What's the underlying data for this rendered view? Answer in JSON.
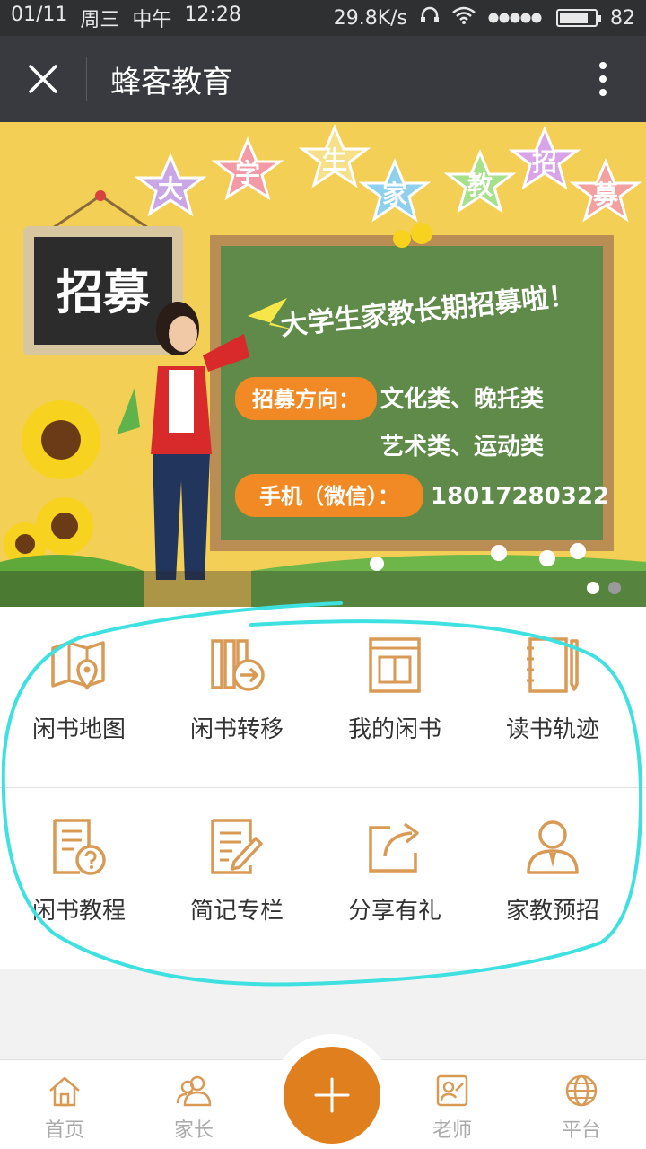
{
  "status": {
    "date": "01/11",
    "weekday": "周三",
    "period": "中午",
    "time": "12:28",
    "speed": "29.8K/s",
    "battery": "82",
    "battery_level": 0.82
  },
  "header": {
    "title": "蜂客教育"
  },
  "banner": {
    "stars": [
      "大",
      "学",
      "生",
      "家",
      "教",
      "招",
      "募"
    ],
    "sign": "招募",
    "headline": "大学生家教长期招募啦！",
    "direction_label": "招募方向：",
    "direction_line1": "文化类、晚托类",
    "direction_line2": "艺术类、运动类",
    "phone_label": "手机（微信）：",
    "phone": "18017280322",
    "slide_count": 2,
    "active_slide": 1
  },
  "grid": {
    "items": [
      {
        "label": "闲书地图",
        "icon": "map-pin-icon"
      },
      {
        "label": "闲书转移",
        "icon": "book-transfer-icon"
      },
      {
        "label": "我的闲书",
        "icon": "my-books-icon"
      },
      {
        "label": "读书轨迹",
        "icon": "notebook-pen-icon"
      },
      {
        "label": "闲书教程",
        "icon": "help-document-icon"
      },
      {
        "label": "简记专栏",
        "icon": "edit-note-icon"
      },
      {
        "label": "分享有礼",
        "icon": "share-icon"
      },
      {
        "label": "家教预招",
        "icon": "teacher-person-icon"
      }
    ]
  },
  "tabbar": {
    "tabs": [
      {
        "label": "首页",
        "icon": "home-icon"
      },
      {
        "label": "家长",
        "icon": "parents-icon"
      },
      {
        "label": "老师",
        "icon": "teacher-icon"
      },
      {
        "label": "平台",
        "icon": "globe-icon"
      }
    ],
    "center_icon": "plus-icon"
  },
  "colors": {
    "accent": "#e07f1e",
    "icon": "#d99a55",
    "header_bg": "#393a3f",
    "highlight": "#3fe0e0"
  }
}
